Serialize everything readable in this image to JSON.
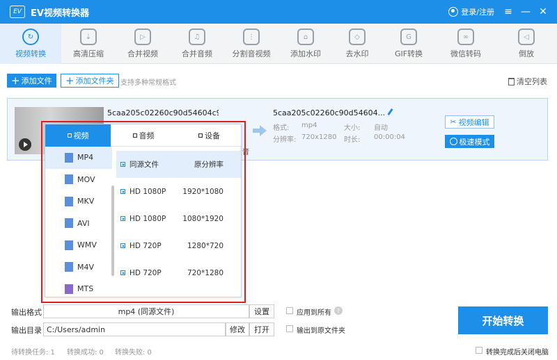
{
  "app": {
    "logo_text": "EV",
    "title": "EV视频转换器",
    "login": "登录/注册",
    "menu_glyph": "≡",
    "min_glyph": "—",
    "close_glyph": "✕"
  },
  "toolbar": [
    {
      "label": "视频转换",
      "icon": "video-convert-icon",
      "glyph": "↻"
    },
    {
      "label": "高清压缩",
      "icon": "compress-icon",
      "glyph": "⇣"
    },
    {
      "label": "合并视频",
      "icon": "merge-video-icon",
      "glyph": "▷"
    },
    {
      "label": "合并音频",
      "icon": "merge-audio-icon",
      "glyph": "♫"
    },
    {
      "label": "分割音视频",
      "icon": "split-icon",
      "glyph": "⋮"
    },
    {
      "label": "添加水印",
      "icon": "watermark-icon",
      "glyph": "⌂"
    },
    {
      "label": "去水印",
      "icon": "remove-watermark-icon",
      "glyph": "◇"
    },
    {
      "label": "GIF转换",
      "icon": "gif-icon",
      "glyph": "G"
    },
    {
      "label": "微信转码",
      "icon": "wechat-icon",
      "glyph": "∞"
    },
    {
      "label": "倒放",
      "icon": "reverse-icon",
      "glyph": "◁"
    }
  ],
  "actions": {
    "add_file": "添加文件",
    "add_folder": "添加文件夹",
    "hint": "支持多种常规格式",
    "clear": "清空列表"
  },
  "file": {
    "source_name": "5caa205c02260c90d54604c96f",
    "source_audio": "音",
    "output_name": "5caa205c02260c90d54604...",
    "format_label": "格式:",
    "format_value": "mp4",
    "size_label": "大小:",
    "size_value": "自动",
    "res_label": "分辨率:",
    "res_value": "720x1280",
    "dur_label": "时长:",
    "dur_value": "00:00:04",
    "edit_btn": "视频编辑",
    "fast_btn": "极速模式"
  },
  "popup": {
    "tabs": [
      "视频",
      "音频",
      "设备"
    ],
    "formats": [
      "MP4",
      "MOV",
      "MKV",
      "AVI",
      "WMV",
      "M4V",
      "MTS"
    ],
    "presets": [
      {
        "name": "同源文件",
        "res": "原分辨率"
      },
      {
        "name": "HD 1080P",
        "res": "1920*1080"
      },
      {
        "name": "HD 1080P",
        "res": "1080*1920"
      },
      {
        "name": "HD 720P",
        "res": "1280*720"
      },
      {
        "name": "HD 720P",
        "res": "720*1280"
      }
    ]
  },
  "bottom": {
    "out_format_label": "输出格式",
    "out_format_value": "mp4 (同源文件)",
    "settings_btn": "设置",
    "apply_all": "应用到所有",
    "help_glyph": "?",
    "out_dir_label": "输出目录",
    "out_dir_value": "C:/Users/admin",
    "modify_btn": "修改",
    "open_btn": "打开",
    "output_src_folder": "输出到原文件夹",
    "start": "开始转换",
    "pending": "待转换任务: 1",
    "success": "转换成功: 0",
    "failed": "转换失败: 0",
    "shutdown": "转换完成后关闭电脑"
  }
}
